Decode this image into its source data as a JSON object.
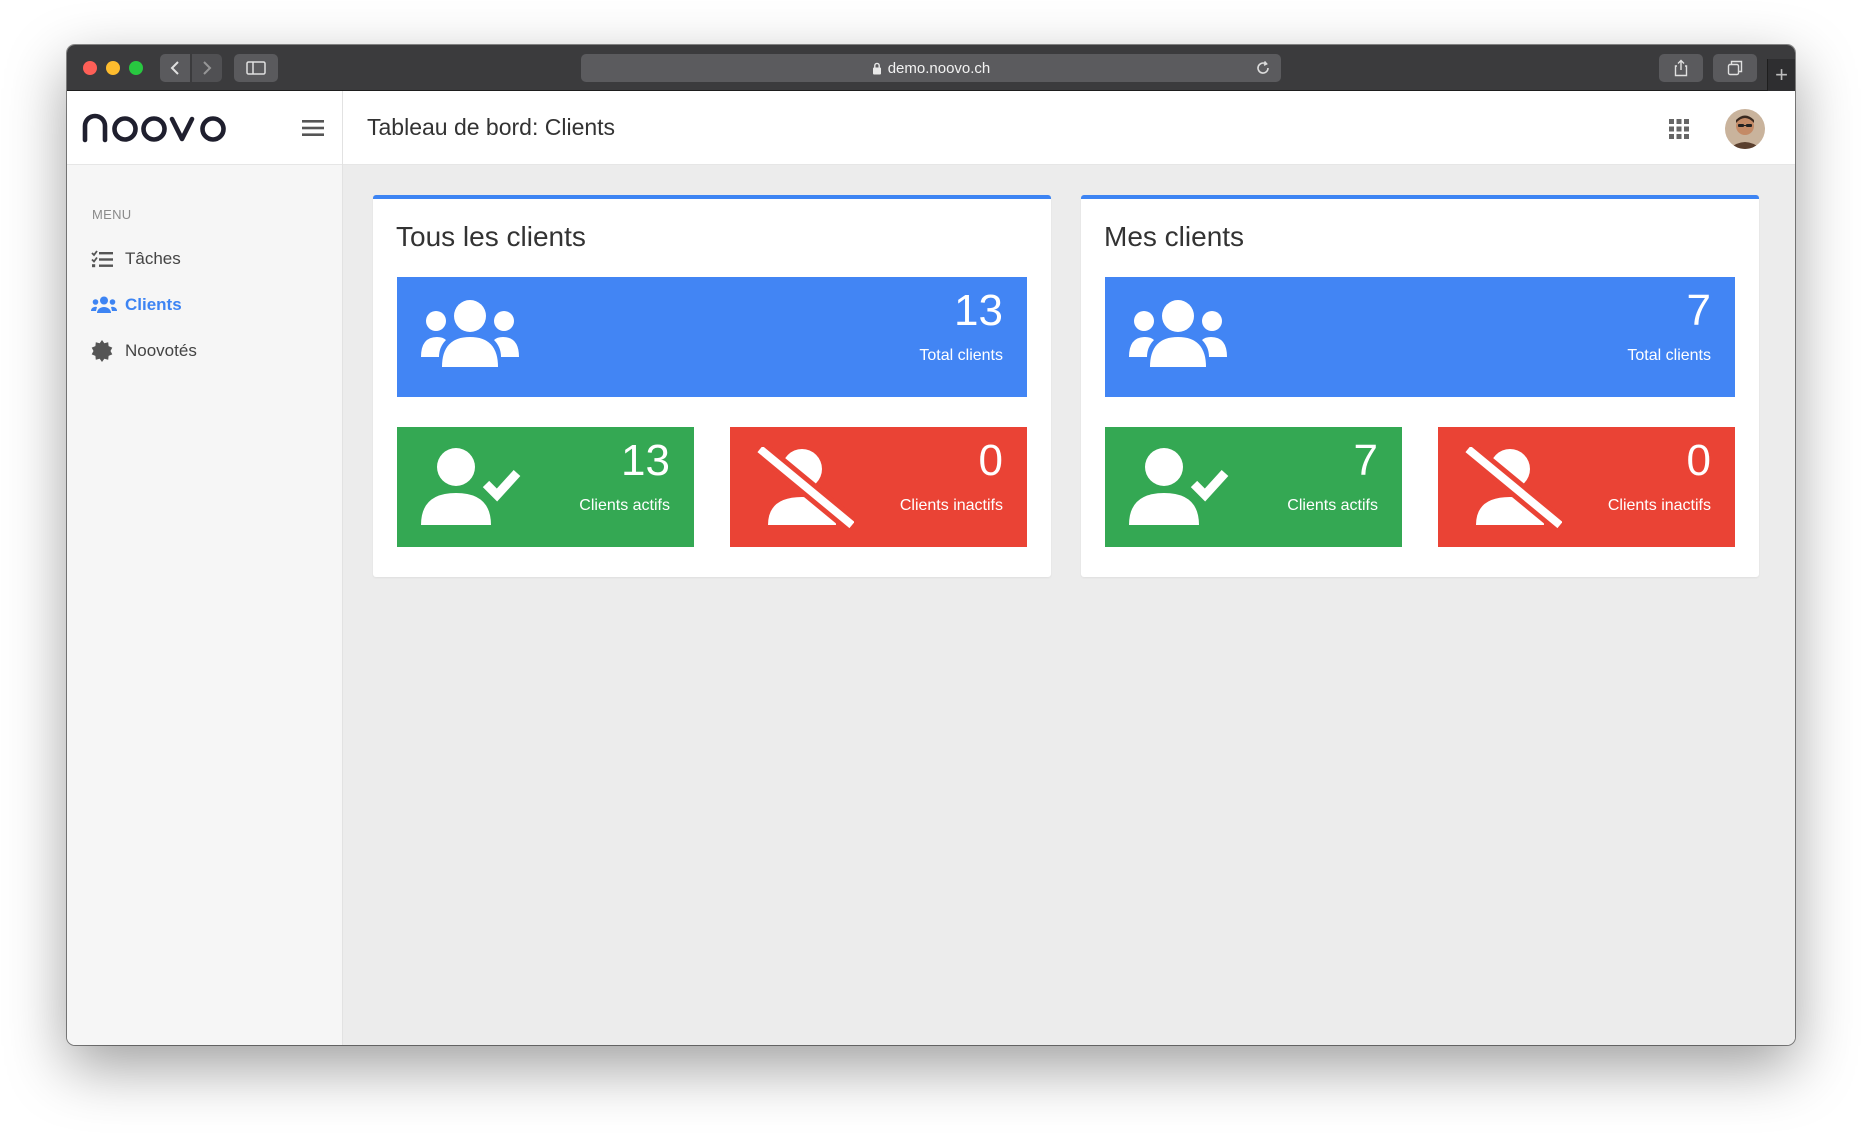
{
  "browser": {
    "url": "demo.noovo.ch"
  },
  "sidebar": {
    "logo": "noovo",
    "menu_label": "MENU",
    "items": [
      {
        "label": "Tâches",
        "icon": "tasks-list-icon",
        "active": false
      },
      {
        "label": "Clients",
        "icon": "users-icon",
        "active": true
      },
      {
        "label": "Noovotés",
        "icon": "badge-icon",
        "active": false
      }
    ]
  },
  "header": {
    "title": "Tableau de bord: Clients"
  },
  "cards": [
    {
      "title": "Tous les clients",
      "total": {
        "value": "13",
        "label": "Total clients"
      },
      "active": {
        "value": "13",
        "label": "Clients actifs"
      },
      "inactive": {
        "value": "0",
        "label": "Clients inactifs"
      }
    },
    {
      "title": "Mes clients",
      "total": {
        "value": "7",
        "label": "Total clients"
      },
      "active": {
        "value": "7",
        "label": "Clients actifs"
      },
      "inactive": {
        "value": "0",
        "label": "Clients inactifs"
      }
    }
  ],
  "colors": {
    "accent": "#3d84f3",
    "blue_tile": "#4285f4",
    "green_tile": "#34a853",
    "red_tile": "#ea4335"
  }
}
